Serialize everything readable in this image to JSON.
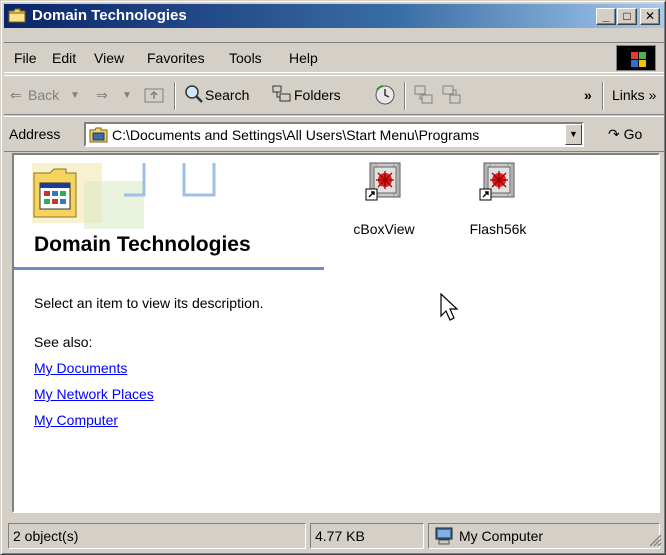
{
  "window": {
    "title": "Domain Technologies",
    "minimize": "_",
    "maximize": "□",
    "close": "✕"
  },
  "menubar": {
    "items": [
      "File",
      "Edit",
      "View",
      "Favorites",
      "Tools",
      "Help"
    ]
  },
  "toolbar": {
    "back_label": "Back",
    "search_label": "Search",
    "folders_label": "Folders",
    "chevron": "»",
    "links_label": "Links »"
  },
  "address": {
    "label": "Address",
    "value": "C:\\Documents and Settings\\All Users\\Start Menu\\Programs",
    "go_label": "Go"
  },
  "webview": {
    "heading": "Domain Technologies",
    "description": "Select an item to view its description.",
    "see_also": "See also:",
    "links": [
      "My Documents",
      "My Network Places",
      "My Computer"
    ]
  },
  "files": [
    {
      "name": "cBoxView",
      "icon": "program-shortcut-icon"
    },
    {
      "name": "Flash56k",
      "icon": "program-shortcut-icon"
    }
  ],
  "statusbar": {
    "objects": "2 object(s)",
    "size": "4.77 KB",
    "zone": "My Computer"
  },
  "colors": {
    "title_start": "#0a246a",
    "title_end": "#a6caf0",
    "link": "#0000ff",
    "heading_rule": "#6e8dc2"
  }
}
